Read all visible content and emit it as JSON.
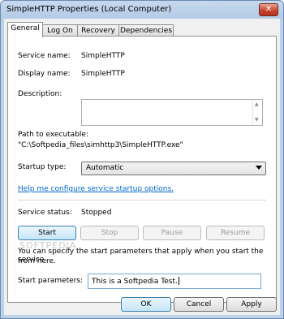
{
  "window": {
    "title": "SimpleHTTP Properties (Local Computer)",
    "close_glyph": "✕"
  },
  "tabs": [
    {
      "label": "General"
    },
    {
      "label": "Log On"
    },
    {
      "label": "Recovery"
    },
    {
      "label": "Dependencies"
    }
  ],
  "general": {
    "service_name_label": "Service name:",
    "service_name_value": "SimpleHTTP",
    "display_name_label": "Display name:",
    "display_name_value": "SimpleHTTP",
    "description_label": "Description:",
    "description_value": "",
    "path_label": "Path to executable:",
    "path_value": "\"C:\\Softpedia_files\\simhttp3\\SimpleHTTP.exe\"",
    "startup_type_label": "Startup type:",
    "startup_type_value": "Automatic",
    "help_link": "Help me configure service startup options.",
    "service_status_label": "Service status:",
    "service_status_value": "Stopped",
    "buttons": {
      "start": "Start",
      "stop": "Stop",
      "pause": "Pause",
      "resume": "Resume"
    },
    "watermark": "SOFTPEDIA",
    "start_params_hint_line1": "You can specify the start parameters that apply when you start the service",
    "start_params_hint_line2": "from here.",
    "start_params_label": "Start parameters:",
    "start_params_value": "This is a Softpedia Test."
  },
  "footer": {
    "ok": "OK",
    "cancel": "Cancel",
    "apply": "Apply"
  },
  "icons": {
    "scroll_up": "▲",
    "scroll_down": "▼"
  }
}
